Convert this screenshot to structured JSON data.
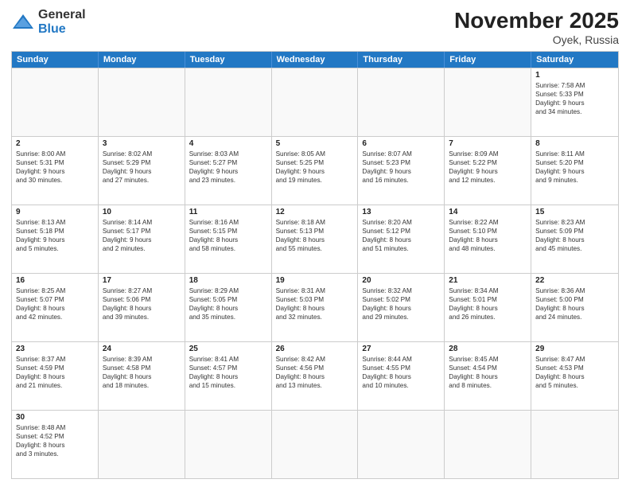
{
  "logo": {
    "general": "General",
    "blue": "Blue"
  },
  "header": {
    "month": "November 2025",
    "location": "Oyek, Russia"
  },
  "weekdays": [
    "Sunday",
    "Monday",
    "Tuesday",
    "Wednesday",
    "Thursday",
    "Friday",
    "Saturday"
  ],
  "rows": [
    [
      {
        "day": "",
        "info": ""
      },
      {
        "day": "",
        "info": ""
      },
      {
        "day": "",
        "info": ""
      },
      {
        "day": "",
        "info": ""
      },
      {
        "day": "",
        "info": ""
      },
      {
        "day": "",
        "info": ""
      },
      {
        "day": "1",
        "info": "Sunrise: 7:58 AM\nSunset: 5:33 PM\nDaylight: 9 hours\nand 34 minutes."
      }
    ],
    [
      {
        "day": "2",
        "info": "Sunrise: 8:00 AM\nSunset: 5:31 PM\nDaylight: 9 hours\nand 30 minutes."
      },
      {
        "day": "3",
        "info": "Sunrise: 8:02 AM\nSunset: 5:29 PM\nDaylight: 9 hours\nand 27 minutes."
      },
      {
        "day": "4",
        "info": "Sunrise: 8:03 AM\nSunset: 5:27 PM\nDaylight: 9 hours\nand 23 minutes."
      },
      {
        "day": "5",
        "info": "Sunrise: 8:05 AM\nSunset: 5:25 PM\nDaylight: 9 hours\nand 19 minutes."
      },
      {
        "day": "6",
        "info": "Sunrise: 8:07 AM\nSunset: 5:23 PM\nDaylight: 9 hours\nand 16 minutes."
      },
      {
        "day": "7",
        "info": "Sunrise: 8:09 AM\nSunset: 5:22 PM\nDaylight: 9 hours\nand 12 minutes."
      },
      {
        "day": "8",
        "info": "Sunrise: 8:11 AM\nSunset: 5:20 PM\nDaylight: 9 hours\nand 9 minutes."
      }
    ],
    [
      {
        "day": "9",
        "info": "Sunrise: 8:13 AM\nSunset: 5:18 PM\nDaylight: 9 hours\nand 5 minutes."
      },
      {
        "day": "10",
        "info": "Sunrise: 8:14 AM\nSunset: 5:17 PM\nDaylight: 9 hours\nand 2 minutes."
      },
      {
        "day": "11",
        "info": "Sunrise: 8:16 AM\nSunset: 5:15 PM\nDaylight: 8 hours\nand 58 minutes."
      },
      {
        "day": "12",
        "info": "Sunrise: 8:18 AM\nSunset: 5:13 PM\nDaylight: 8 hours\nand 55 minutes."
      },
      {
        "day": "13",
        "info": "Sunrise: 8:20 AM\nSunset: 5:12 PM\nDaylight: 8 hours\nand 51 minutes."
      },
      {
        "day": "14",
        "info": "Sunrise: 8:22 AM\nSunset: 5:10 PM\nDaylight: 8 hours\nand 48 minutes."
      },
      {
        "day": "15",
        "info": "Sunrise: 8:23 AM\nSunset: 5:09 PM\nDaylight: 8 hours\nand 45 minutes."
      }
    ],
    [
      {
        "day": "16",
        "info": "Sunrise: 8:25 AM\nSunset: 5:07 PM\nDaylight: 8 hours\nand 42 minutes."
      },
      {
        "day": "17",
        "info": "Sunrise: 8:27 AM\nSunset: 5:06 PM\nDaylight: 8 hours\nand 39 minutes."
      },
      {
        "day": "18",
        "info": "Sunrise: 8:29 AM\nSunset: 5:05 PM\nDaylight: 8 hours\nand 35 minutes."
      },
      {
        "day": "19",
        "info": "Sunrise: 8:31 AM\nSunset: 5:03 PM\nDaylight: 8 hours\nand 32 minutes."
      },
      {
        "day": "20",
        "info": "Sunrise: 8:32 AM\nSunset: 5:02 PM\nDaylight: 8 hours\nand 29 minutes."
      },
      {
        "day": "21",
        "info": "Sunrise: 8:34 AM\nSunset: 5:01 PM\nDaylight: 8 hours\nand 26 minutes."
      },
      {
        "day": "22",
        "info": "Sunrise: 8:36 AM\nSunset: 5:00 PM\nDaylight: 8 hours\nand 24 minutes."
      }
    ],
    [
      {
        "day": "23",
        "info": "Sunrise: 8:37 AM\nSunset: 4:59 PM\nDaylight: 8 hours\nand 21 minutes."
      },
      {
        "day": "24",
        "info": "Sunrise: 8:39 AM\nSunset: 4:58 PM\nDaylight: 8 hours\nand 18 minutes."
      },
      {
        "day": "25",
        "info": "Sunrise: 8:41 AM\nSunset: 4:57 PM\nDaylight: 8 hours\nand 15 minutes."
      },
      {
        "day": "26",
        "info": "Sunrise: 8:42 AM\nSunset: 4:56 PM\nDaylight: 8 hours\nand 13 minutes."
      },
      {
        "day": "27",
        "info": "Sunrise: 8:44 AM\nSunset: 4:55 PM\nDaylight: 8 hours\nand 10 minutes."
      },
      {
        "day": "28",
        "info": "Sunrise: 8:45 AM\nSunset: 4:54 PM\nDaylight: 8 hours\nand 8 minutes."
      },
      {
        "day": "29",
        "info": "Sunrise: 8:47 AM\nSunset: 4:53 PM\nDaylight: 8 hours\nand 5 minutes."
      }
    ],
    [
      {
        "day": "30",
        "info": "Sunrise: 8:48 AM\nSunset: 4:52 PM\nDaylight: 8 hours\nand 3 minutes."
      },
      {
        "day": "",
        "info": ""
      },
      {
        "day": "",
        "info": ""
      },
      {
        "day": "",
        "info": ""
      },
      {
        "day": "",
        "info": ""
      },
      {
        "day": "",
        "info": ""
      },
      {
        "day": "",
        "info": ""
      }
    ]
  ]
}
